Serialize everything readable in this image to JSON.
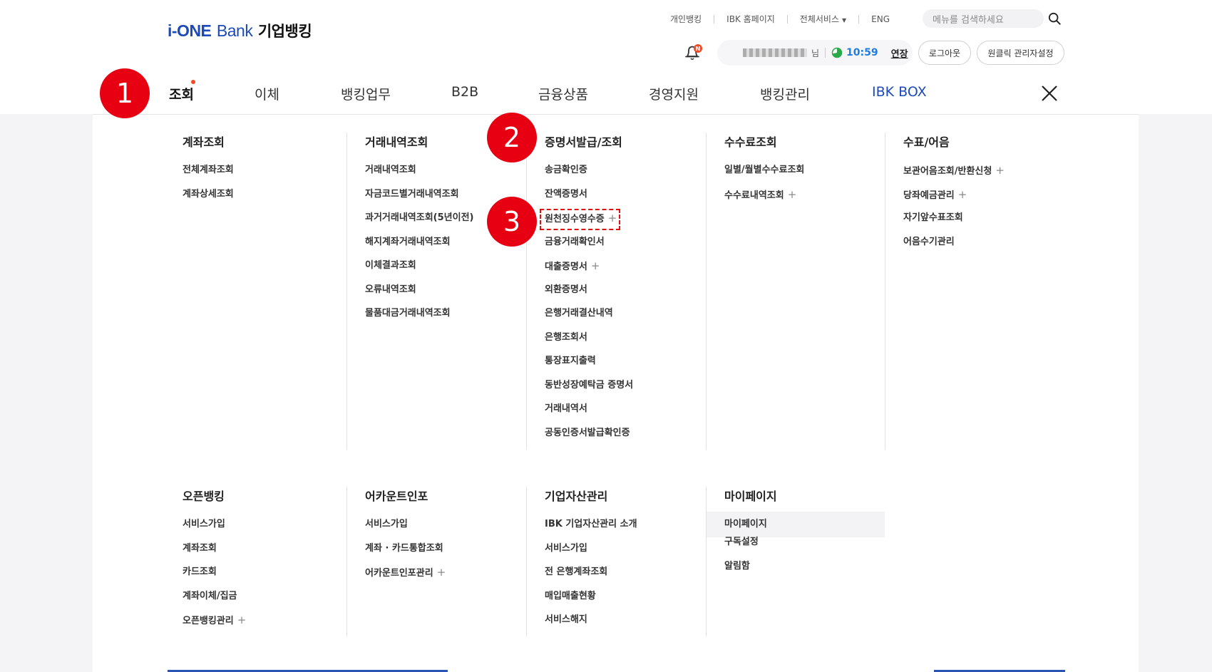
{
  "header": {
    "logo": {
      "ione": "i-ONE",
      "bank": "Bank",
      "kor": "기업뱅킹"
    },
    "util_links": [
      "개인뱅킹",
      "IBK 홈페이지",
      "전체서비스",
      "ENG"
    ],
    "search_placeholder": "메뉴를 검색하세요",
    "notification_badge": "N",
    "user_suffix": "님",
    "session_time": "10:59",
    "extend_label": "연장",
    "logout_label": "로그아웃",
    "admin_label": "원클릭 관리자설정"
  },
  "gnb": {
    "items": [
      "조회",
      "이체",
      "뱅킹업무",
      "B2B",
      "금융상품",
      "경영지원",
      "뱅킹관리",
      "IBK BOX"
    ],
    "active_index": 0
  },
  "menu": {
    "row1": [
      {
        "title": "계좌조회",
        "items": [
          {
            "label": "전체계좌조회"
          },
          {
            "label": "계좌상세조회"
          }
        ]
      },
      {
        "title": "거래내역조회",
        "items": [
          {
            "label": "거래내역조회"
          },
          {
            "label": "자금코드별거래내역조회"
          },
          {
            "label": "과거거래내역조회(5년이전)"
          },
          {
            "label": "해지계좌거래내역조회"
          },
          {
            "label": "이체결과조회"
          },
          {
            "label": "오류내역조회"
          },
          {
            "label": "물품대금거래내역조회"
          }
        ]
      },
      {
        "title": "증명서발급/조회",
        "items": [
          {
            "label": "송금확인증"
          },
          {
            "label": "잔액증명서"
          },
          {
            "label": "원천징수영수증",
            "plus": "+"
          },
          {
            "label": "금융거래확인서"
          },
          {
            "label": "대출증명서",
            "plus": "+"
          },
          {
            "label": "외환증명서"
          },
          {
            "label": "은행거래결산내역"
          },
          {
            "label": "은행조회서"
          },
          {
            "label": "통장표지출력"
          },
          {
            "label": "동반성장예탁금 증명서"
          },
          {
            "label": "거래내역서"
          },
          {
            "label": "공동인증서발급확인증"
          }
        ]
      },
      {
        "title": "수수료조회",
        "items": [
          {
            "label": "일별/월별수수료조회"
          },
          {
            "label": "수수료내역조회",
            "plus": "+"
          }
        ]
      },
      {
        "title": "수표/어음",
        "items": [
          {
            "label": "보관어음조회/반환신청",
            "plus": "+"
          },
          {
            "label": "당좌예금관리",
            "plus": "+"
          },
          {
            "label": "자기앞수표조회"
          },
          {
            "label": "어음수기관리"
          }
        ]
      }
    ],
    "row2": [
      {
        "title": "오픈뱅킹",
        "items": [
          {
            "label": "서비스가입"
          },
          {
            "label": "계좌조회"
          },
          {
            "label": "카드조회"
          },
          {
            "label": "계좌이체/집금"
          },
          {
            "label": "오픈뱅킹관리",
            "plus": "+"
          }
        ]
      },
      {
        "title": "어카운트인포",
        "items": [
          {
            "label": "서비스가입"
          },
          {
            "label": "계좌 · 카드통합조회"
          },
          {
            "label": "어카운트인포관리",
            "plus": "+"
          }
        ]
      },
      {
        "title": "기업자산관리",
        "items": [
          {
            "label": "IBK 기업자산관리 소개"
          },
          {
            "label": "서비스가입"
          },
          {
            "label": "전 은행계좌조회"
          },
          {
            "label": "매입매출현황"
          },
          {
            "label": "서비스해지"
          }
        ]
      },
      {
        "title": "마이페이지",
        "items": [
          {
            "label": "마이페이지"
          },
          {
            "label": "구독설정"
          },
          {
            "label": "알림함"
          }
        ]
      }
    ]
  },
  "markers": [
    "1",
    "2",
    "3"
  ],
  "colors": {
    "brand": "#1c4ab8",
    "marker": "#e60012",
    "timer": "#1f7de0",
    "dot": "#f04a2a"
  }
}
